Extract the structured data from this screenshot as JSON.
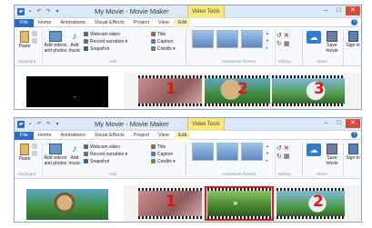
{
  "top_window": {
    "title": "My Movie - Movie Maker",
    "contextual_tab": "Video Tools",
    "tabs": [
      "File",
      "Home",
      "Animations",
      "Visual Effects",
      "Project",
      "View",
      "Edit"
    ],
    "ribbon": {
      "paste": "Paste",
      "add_videos": "Add videos and photos",
      "add_music": "Add music",
      "webcam": "Webcam video",
      "record_narration": "Record narration",
      "snapshot": "Snapshot",
      "title": "Title",
      "caption": "Caption",
      "credits": "Credits",
      "save_movie": "Save movie",
      "sign_in": "Sign in"
    },
    "group_labels": {
      "clipboard": "Clipboard",
      "add": "Add",
      "automovie": "AutoMovie themes",
      "editing": "Editing",
      "share": "Share"
    },
    "clip_numbers": [
      "1",
      "2",
      "3"
    ]
  },
  "bottom_window": {
    "title": "My Movie - Movie Maker",
    "contextual_tab": "Video Tools",
    "tabs": [
      "File",
      "Home",
      "Animations",
      "Visual Effects",
      "Project",
      "View",
      "Edit"
    ],
    "ribbon": {
      "paste": "Paste",
      "add_videos": "Add videos and photos",
      "add_music": "Add music",
      "webcam": "Webcam video",
      "record_narration": "Record narration",
      "snapshot": "Snapshot",
      "title": "Title",
      "caption": "Caption",
      "credits": "Credits",
      "save_movie": "Save movie",
      "sign_in": "Sign in"
    },
    "group_labels": {
      "clipboard": "Clipboard",
      "add": "Add",
      "automovie": "AutoMovie themes",
      "editing": "Editing",
      "share": "Share"
    },
    "clip_numbers": [
      "1",
      "2"
    ]
  },
  "icons": [
    "app-logo-icon",
    "save-icon",
    "undo-icon",
    "redo-icon",
    "minimize-icon",
    "maximize-icon",
    "close-icon",
    "help-icon",
    "paste-icon",
    "cut-icon",
    "copy-icon",
    "add-videos-icon",
    "music-note-icon",
    "webcam-icon",
    "microphone-icon",
    "camera-icon",
    "title-icon",
    "caption-icon",
    "credits-icon",
    "rotate-left-icon",
    "delete-icon",
    "rotate-right-icon",
    "select-all-icon",
    "onedrive-icon",
    "save-movie-icon",
    "sign-in-icon",
    "play-icon",
    "cursor-arrow-icon"
  ],
  "colors": {
    "accent": "#2b6cc4",
    "contextual_tab": "#f6e889",
    "highlight": "#e21a1a"
  }
}
